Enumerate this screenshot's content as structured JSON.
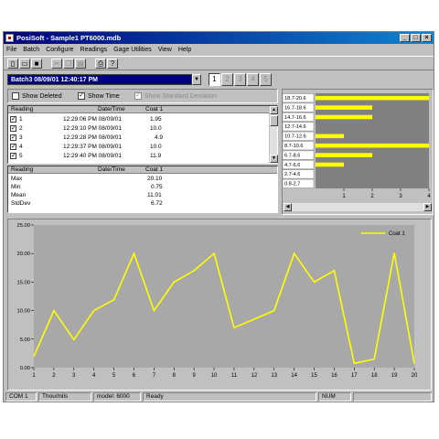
{
  "window": {
    "title": "PosiSoft - Sample1 PT6000.mdb",
    "controls": [
      "_",
      "□",
      "×"
    ]
  },
  "menu": [
    "File",
    "Batch",
    "Configure",
    "Readings",
    "Gage Utilities",
    "View",
    "Help"
  ],
  "toolbar": {
    "icons": [
      "new-file-icon",
      "open-folder-icon",
      "save-disk-icon",
      "cut-icon",
      "copy-icon",
      "paste-icon",
      "print-icon",
      "help-icon"
    ]
  },
  "batch": {
    "selected": "Batch3  08/09/01 12:40:17 PM",
    "tabs": [
      "1",
      "2",
      "3",
      "4",
      "5"
    ],
    "active_tab": "1"
  },
  "options": {
    "show_deleted": "Show Deleted",
    "show_time": "Show Time",
    "show_std_dev": "Show Standard Deviation"
  },
  "readings_table": {
    "headers": [
      "Reading",
      "Date/Time",
      "Coat 1"
    ],
    "rows": [
      {
        "reading": "1",
        "datetime": "12:29:06 PM 08/09/01",
        "coat": "1.95"
      },
      {
        "reading": "2",
        "datetime": "12:29:10 PM 08/09/01",
        "coat": "10.0"
      },
      {
        "reading": "3",
        "datetime": "12:29:28 PM 08/09/01",
        "coat": "4.9"
      },
      {
        "reading": "4",
        "datetime": "12:29:37 PM 08/09/01",
        "coat": "10.0"
      },
      {
        "reading": "5",
        "datetime": "12:29:40 PM 08/09/01",
        "coat": "11.9"
      }
    ]
  },
  "stats_table": {
    "headers": [
      "Reading",
      "Date/Time",
      "Coat 1"
    ],
    "rows": [
      {
        "label": "Max",
        "value": "20.10"
      },
      {
        "label": "Min",
        "value": "0.75"
      },
      {
        "label": "Mean",
        "value": "11.01"
      },
      {
        "label": "StdDev",
        "value": "6.72"
      }
    ]
  },
  "colors": {
    "accent": "#000080",
    "chart_bg": "#c0c0c0",
    "plot_bg": "#a8a8a8",
    "series": "#ffff00"
  },
  "chart_data": [
    {
      "type": "bar",
      "orientation": "horizontal",
      "categories": [
        "18.7-20.6",
        "16.7-18.6",
        "14.7-16.6",
        "12.7-14.6",
        "10.7-12.6",
        "8.7-10.6",
        "6.7-8.6",
        "4.7-6.6",
        "2.7-4.6",
        "0.8-2.7"
      ],
      "values": [
        4,
        2,
        2,
        0,
        1,
        4,
        2,
        1,
        0,
        0
      ],
      "xlim": [
        0,
        4
      ],
      "xticks": [
        "1",
        "2",
        "3",
        "4"
      ]
    },
    {
      "type": "line",
      "x": [
        1,
        2,
        3,
        4,
        5,
        6,
        7,
        8,
        9,
        10,
        11,
        12,
        13,
        14,
        15,
        16,
        17,
        18,
        19,
        20
      ],
      "series": [
        {
          "name": "Coat 1",
          "values": [
            1.95,
            10.0,
            4.9,
            10.0,
            11.9,
            20.0,
            10.0,
            15.0,
            17.0,
            20.0,
            7.0,
            8.5,
            10.0,
            20.0,
            15.0,
            17.0,
            0.75,
            1.5,
            20.1,
            0.75
          ]
        }
      ],
      "ylim": [
        0,
        25
      ],
      "yticks": [
        "0.00",
        "5.00",
        "10.00",
        "15.00",
        "20.00",
        "25.00"
      ],
      "xticks": [
        "1",
        "2",
        "3",
        "4",
        "5",
        "6",
        "7",
        "8",
        "9",
        "10",
        "11",
        "12",
        "13",
        "14",
        "15",
        "16",
        "17",
        "18",
        "19",
        "20"
      ],
      "legend": "top-right"
    }
  ],
  "status": {
    "port": "COM 1",
    "units": "Thou/mils",
    "model": "model: 6000",
    "state": "Ready",
    "num": "NUM"
  }
}
